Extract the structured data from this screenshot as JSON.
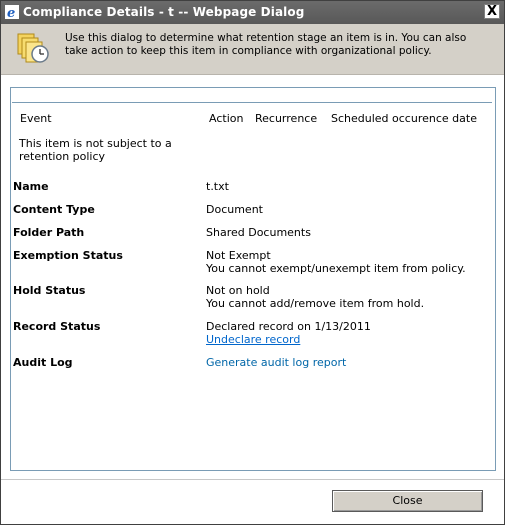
{
  "window": {
    "title": "Compliance Details - t -- Webpage Dialog",
    "close_glyph": "X"
  },
  "header": {
    "description": "Use this dialog to determine what retention stage an item is in. You can also take action to keep this item in compliance with organizational policy.",
    "icon": "documents-clock-icon"
  },
  "retention_table": {
    "columns": {
      "event": "Event",
      "action": "Action",
      "recurrence": "Recurrence",
      "scheduled": "Scheduled occurence date"
    },
    "empty_message": "This item is not subject to a retention policy"
  },
  "details": {
    "name": {
      "label": "Name",
      "value": "t.txt"
    },
    "content_type": {
      "label": "Content Type",
      "value": "Document"
    },
    "folder_path": {
      "label": "Folder Path",
      "value": "Shared Documents"
    },
    "exemption_status": {
      "label": "Exemption Status",
      "value": "Not Exempt",
      "note": "You cannot exempt/unexempt item from policy."
    },
    "hold_status": {
      "label": "Hold Status",
      "value": "Not on hold",
      "note": "You cannot add/remove item from hold."
    },
    "record_status": {
      "label": "Record Status",
      "value": "Declared record on 1/13/2011",
      "action_link": "Undeclare record"
    },
    "audit_log": {
      "label": "Audit Log",
      "action_link": "Generate audit log report"
    }
  },
  "footer": {
    "close_label": "Close"
  },
  "colors": {
    "titlebar": "#5f5f5f",
    "header_bg": "#d4d0c8",
    "frame_border": "#7a9cb5",
    "link": "#0066a8"
  }
}
